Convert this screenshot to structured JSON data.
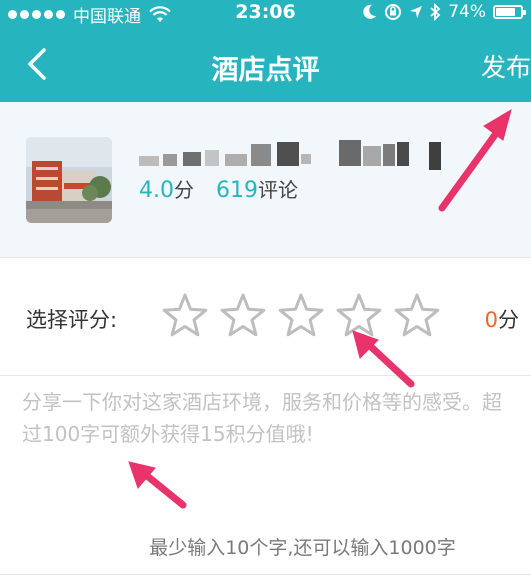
{
  "status_bar": {
    "carrier": "中国联通",
    "time": "23:06",
    "battery": "74%",
    "icons": [
      "signal-dots-icon",
      "wifi-icon",
      "moon-icon",
      "rotation-lock-icon",
      "location-icon",
      "bluetooth-icon",
      "battery-icon"
    ]
  },
  "nav": {
    "back_icon": "chevron-left-icon",
    "title": "酒店点评",
    "publish_label": "发布"
  },
  "hotel": {
    "photo": "hotel-thumbnail",
    "name_blurred": true,
    "score_value": "4.0",
    "score_unit": "分",
    "review_count": "619",
    "review_unit": "评论"
  },
  "rating": {
    "label": "选择评分:",
    "stars_total": 5,
    "stars_selected": 0,
    "score_value": "0",
    "score_unit": "分"
  },
  "comment": {
    "value": "",
    "placeholder": "分享一下你对这家酒店环境，服务和价格等的感受。超过100字可额外获得15积分值哦!",
    "hint": "最少输入10个字,还可以输入1000字"
  },
  "colors": {
    "header": "#26b5bf",
    "accent": "#26b5bf",
    "score_zero": "#f0652a",
    "annotation_arrow": "#e8336b"
  }
}
